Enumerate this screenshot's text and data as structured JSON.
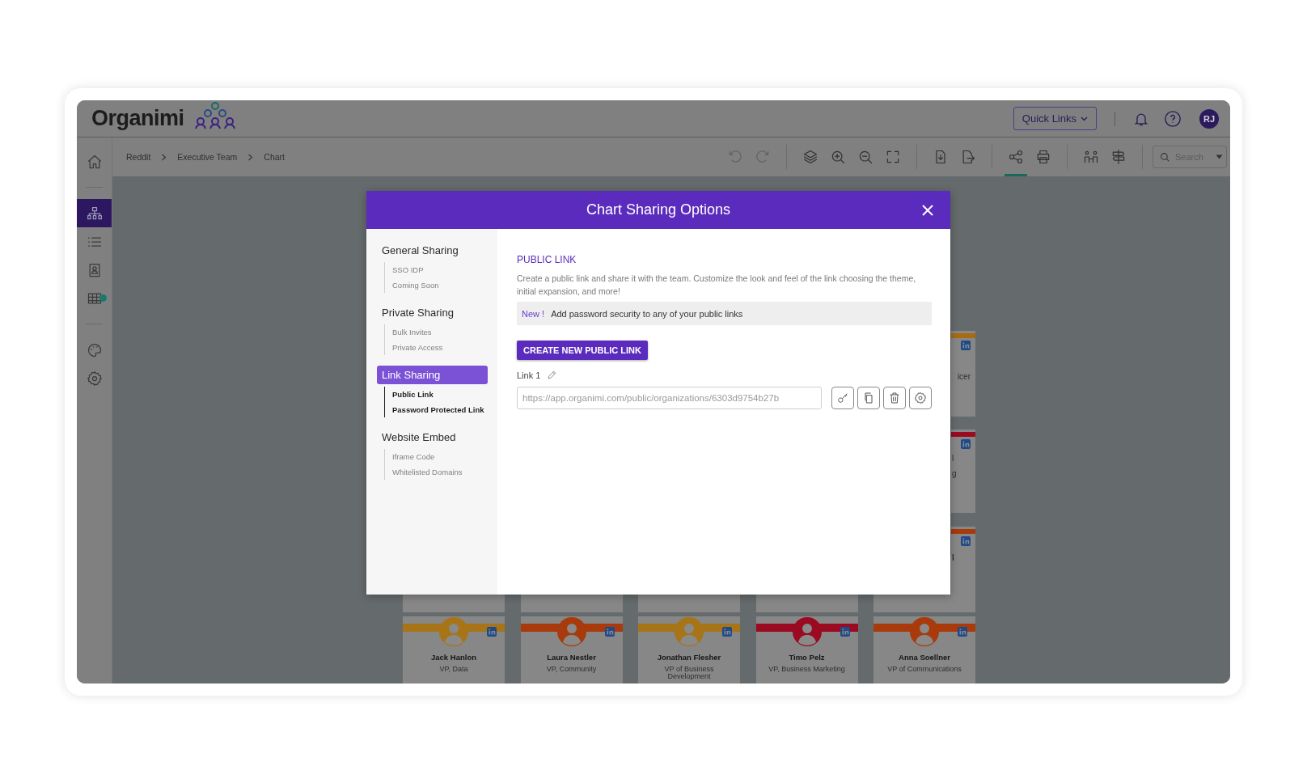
{
  "header": {
    "logo": "Organimi",
    "quick_links": "Quick Links",
    "avatar": "RJ"
  },
  "breadcrumb": [
    "Reddit",
    "Executive Team",
    "Chart"
  ],
  "toolbar_groups": [
    [
      {
        "kind": "undo",
        "disabled": true,
        "selected": false
      },
      {
        "kind": "redo",
        "disabled": true,
        "selected": false
      }
    ],
    [
      {
        "kind": "layers",
        "disabled": false,
        "selected": false
      },
      {
        "kind": "zoomin",
        "disabled": false,
        "selected": false
      },
      {
        "kind": "zoomout",
        "disabled": false,
        "selected": false
      },
      {
        "kind": "fit",
        "disabled": false,
        "selected": false
      }
    ],
    [
      {
        "kind": "download",
        "disabled": false,
        "selected": false
      },
      {
        "kind": "export",
        "disabled": false,
        "selected": false
      }
    ],
    [
      {
        "kind": "share",
        "disabled": false,
        "selected": true
      },
      {
        "kind": "print",
        "disabled": false,
        "selected": false
      }
    ],
    [
      {
        "kind": "people",
        "disabled": false,
        "selected": false
      },
      {
        "kind": "signpost",
        "disabled": false,
        "selected": false
      }
    ]
  ],
  "search": {
    "placeholder": "Search"
  },
  "sidebar_groups": [
    [
      {
        "kind": "home",
        "selected": false,
        "badge": false
      }
    ],
    [
      {
        "kind": "org",
        "selected": true,
        "badge": false
      },
      {
        "kind": "list",
        "selected": false,
        "badge": false
      },
      {
        "kind": "contact",
        "selected": false,
        "badge": false
      },
      {
        "kind": "table",
        "selected": false,
        "badge": true
      }
    ],
    [
      {
        "kind": "palette",
        "selected": false,
        "badge": false
      },
      {
        "kind": "settings",
        "selected": false,
        "badge": false
      }
    ]
  ],
  "chart": {
    "cards": [
      {
        "name": "Jack Hanlon",
        "title": "VP, Data",
        "color": "#a87418"
      },
      {
        "name": "Laura Nestler",
        "title": "VP, Community",
        "color": "#a83a0c"
      },
      {
        "name": "Jonathan Flesher",
        "title": "VP of Business Development",
        "color": "#a87418"
      },
      {
        "name": "Timo Pelz",
        "title": "VP, Business Marketing",
        "color": "#9a0a20"
      },
      {
        "name": "Anna Soellner",
        "title": "VP of Communications",
        "color": "#a83a0c"
      }
    ],
    "partial_cards": [
      {
        "color": "#a86c10",
        "lines": [
          "icer"
        ]
      },
      {
        "color": "#9a0a20",
        "lines": [
          "l",
          "g"
        ]
      },
      {
        "color": "#a83a0c",
        "lines": [
          "l"
        ]
      }
    ]
  },
  "modal": {
    "title": "Chart Sharing Options",
    "nav": [
      {
        "label": "General Sharing",
        "selected": false,
        "children": [
          {
            "label": "SSO IDP"
          },
          {
            "label": "Coming Soon"
          }
        ]
      },
      {
        "label": "Private Sharing",
        "selected": false,
        "children": [
          {
            "label": "Bulk Invites"
          },
          {
            "label": "Private Access"
          }
        ]
      },
      {
        "label": "Link Sharing",
        "selected": true,
        "children": [
          {
            "label": "Public Link"
          },
          {
            "label": "Password Protected Link"
          }
        ]
      },
      {
        "label": "Website Embed",
        "selected": false,
        "children": [
          {
            "label": "Iframe Code"
          },
          {
            "label": "Whitelisted Domains"
          }
        ]
      }
    ],
    "section": {
      "heading": "PUBLIC LINK",
      "description": "Create a public link and share it with the team. Customize the look and feel of the link choosing the theme, initial expansion, and more!",
      "notice": {
        "tag": "New !",
        "text": "Add password security to any of your public links"
      },
      "create_button": "CREATE NEW PUBLIC LINK",
      "link": {
        "label": "Link 1",
        "url": "https://app.organimi.com/public/organizations/6303d9754b27b"
      },
      "actions": [
        {
          "kind": "key"
        },
        {
          "kind": "copy"
        },
        {
          "kind": "trash"
        },
        {
          "kind": "settings"
        }
      ]
    }
  }
}
